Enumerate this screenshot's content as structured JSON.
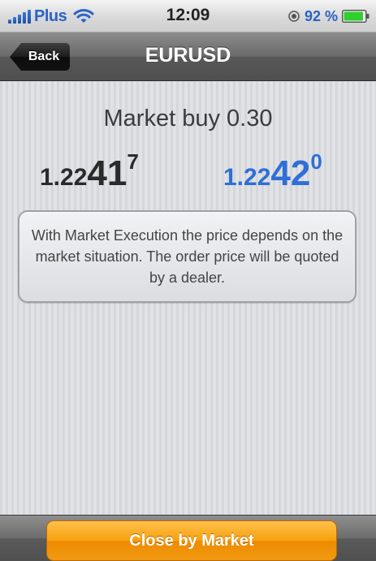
{
  "status_bar": {
    "carrier": "Plus",
    "time": "12:09",
    "battery_percent": "92 %",
    "signal_icon": "signal-bars-icon",
    "wifi_icon": "wifi-icon",
    "lock_icon": "orientation-lock-icon",
    "battery_icon": "battery-icon",
    "battery_level": 0.92
  },
  "nav": {
    "back_label": "Back",
    "title": "EURUSD"
  },
  "order": {
    "title": "Market buy 0.30",
    "bid": {
      "base": "1.22",
      "big": "41",
      "sup": "7"
    },
    "ask": {
      "base": "1.22",
      "big": "42",
      "sup": "0"
    },
    "info": "With Market Execution the price depends on the market situation. The order price will be quoted by a dealer."
  },
  "toolbar": {
    "close_label": "Close by Market"
  },
  "colors": {
    "ask_price": "#2f6fd6",
    "bid_price": "#2a2a2a",
    "close_button": "#f7a10e",
    "battery": "#2fcf2f"
  }
}
